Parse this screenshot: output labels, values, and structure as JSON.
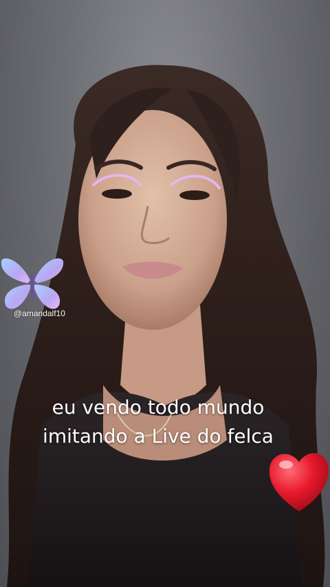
{
  "video": {
    "watermark_handle": "@amandalf10",
    "caption_lines": [
      "eu vendo todo mundo",
      "imitando a Live do felca"
    ],
    "stickers": {
      "top_left": "butterfly-icon",
      "bottom_right": "heart-icon"
    }
  },
  "colors": {
    "background": "#6d6e73",
    "caption_text": "#ffffff",
    "heart": "#e8192c",
    "butterfly": "#9fb8f5"
  }
}
